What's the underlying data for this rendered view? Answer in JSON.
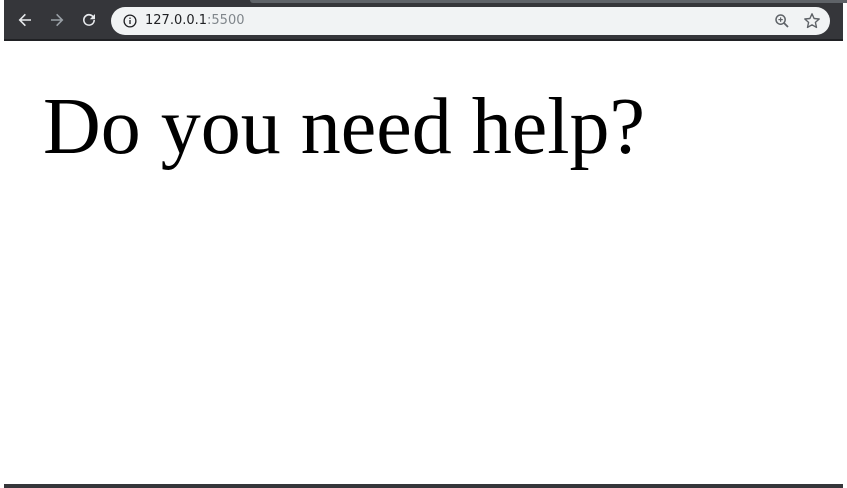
{
  "browser": {
    "url_host": "127.0.0.1",
    "url_port": ":5500",
    "icons": {
      "back": "arrow-left-icon",
      "forward": "arrow-right-icon",
      "reload": "reload-icon",
      "site_info": "info-icon",
      "zoom": "zoom-in-icon",
      "bookmark": "star-icon"
    },
    "colors": {
      "toolbar": "#35363a",
      "omnibox": "#f1f3f4",
      "icon_active": "#e8eaed",
      "icon_disabled": "#9aa0a6"
    }
  },
  "page": {
    "heading": "Do you need help?"
  }
}
